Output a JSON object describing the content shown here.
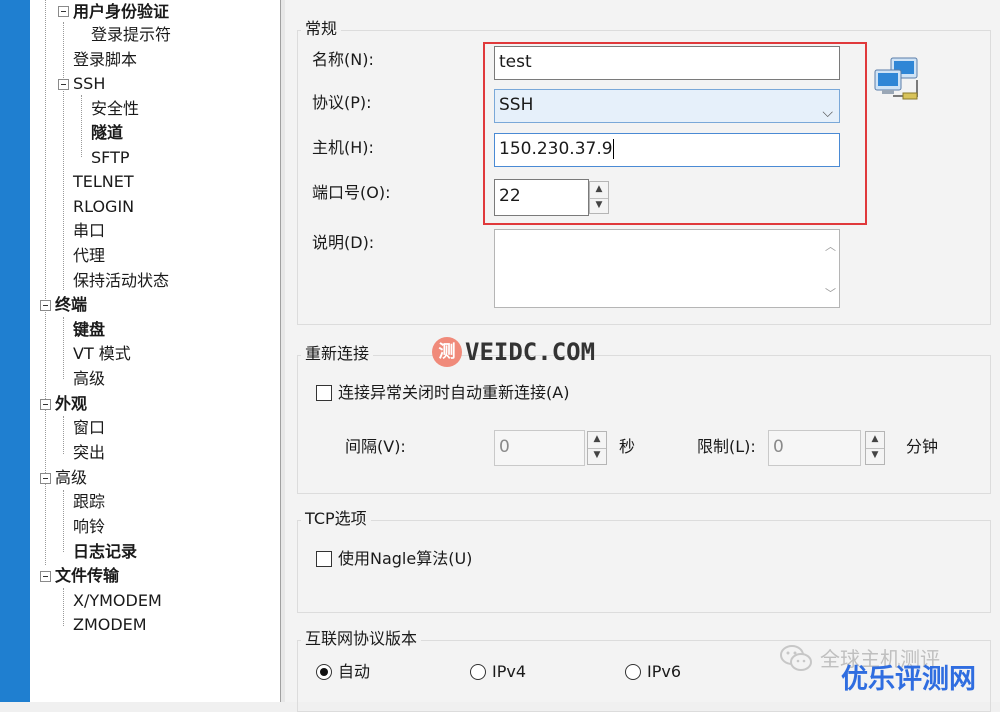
{
  "tree": {
    "items": [
      {
        "label": "用户身份验证",
        "bold": true
      },
      {
        "label": "登录提示符",
        "bold": false
      },
      {
        "label": "登录脚本",
        "bold": false
      },
      {
        "label": "SSH",
        "bold": false
      },
      {
        "label": "安全性",
        "bold": false
      },
      {
        "label": "隧道",
        "bold": true
      },
      {
        "label": "SFTP",
        "bold": false
      },
      {
        "label": "TELNET",
        "bold": false
      },
      {
        "label": "RLOGIN",
        "bold": false
      },
      {
        "label": "串口",
        "bold": false
      },
      {
        "label": "代理",
        "bold": false
      },
      {
        "label": "保持活动状态",
        "bold": false
      },
      {
        "label": "终端",
        "bold": true
      },
      {
        "label": "键盘",
        "bold": true
      },
      {
        "label": "VT 模式",
        "bold": false
      },
      {
        "label": "高级",
        "bold": false
      },
      {
        "label": "外观",
        "bold": true
      },
      {
        "label": "窗口",
        "bold": false
      },
      {
        "label": "突出",
        "bold": false
      },
      {
        "label": "高级",
        "bold": false
      },
      {
        "label": "跟踪",
        "bold": false
      },
      {
        "label": "响铃",
        "bold": false
      },
      {
        "label": "日志记录",
        "bold": true
      },
      {
        "label": "文件传输",
        "bold": true
      },
      {
        "label": "X/YMODEM",
        "bold": false
      },
      {
        "label": "ZMODEM",
        "bold": false
      }
    ]
  },
  "general": {
    "title": "常规",
    "name_label": "名称(N):",
    "name_value": "test",
    "protocol_label": "协议(P):",
    "protocol_value": "SSH",
    "host_label": "主机(H):",
    "host_value": "150.230.37.9",
    "port_label": "端口号(O):",
    "port_value": "22",
    "desc_label": "说明(D):"
  },
  "reconnect": {
    "title": "重新连接",
    "auto_label": "连接异常关闭时自动重新连接(A)",
    "interval_label": "间隔(V):",
    "interval_value": "0",
    "interval_unit": "秒",
    "limit_label": "限制(L):",
    "limit_value": "0",
    "limit_unit": "分钟"
  },
  "tcp": {
    "title": "TCP选项",
    "nagle_label": "使用Nagle算法(U)"
  },
  "ipver": {
    "title": "互联网协议版本",
    "options": [
      {
        "label": "自动",
        "checked": true
      },
      {
        "label": "IPv4",
        "checked": false
      },
      {
        "label": "IPv6",
        "checked": false
      }
    ]
  },
  "watermarks": {
    "center_badge": "测",
    "center_text": "VEIDC.COM",
    "wechat_text": "全球主机测评",
    "bottom_text": "优乐评测网"
  },
  "colors": {
    "highlight": "#e0393b",
    "taskbar": "#1f7fd0",
    "bottom_watermark": "#2f6de0"
  }
}
